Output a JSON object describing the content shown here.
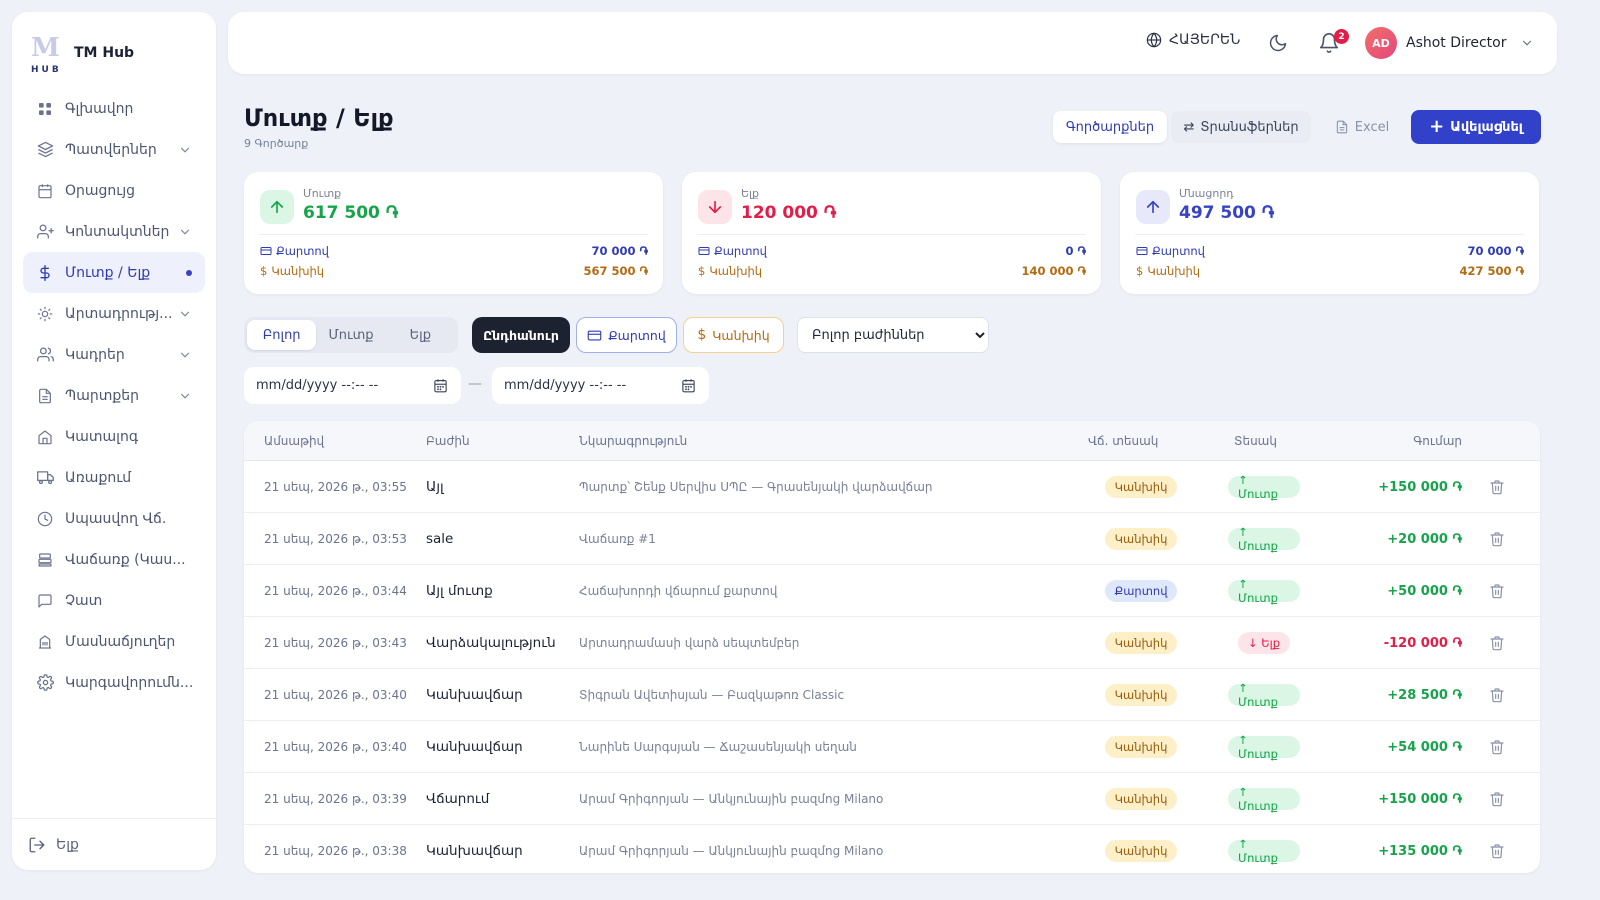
{
  "brand": {
    "name": "TM Hub",
    "logo_letters": "TM",
    "logo_sub": "HUB"
  },
  "sidebar": {
    "items": [
      {
        "label": "Գլխավոր",
        "icon": "grid-icon",
        "has_children": false,
        "active": false
      },
      {
        "label": "Պատվերներ",
        "icon": "layers-icon",
        "has_children": true,
        "active": false
      },
      {
        "label": "Օրացույց",
        "icon": "calendar-icon",
        "has_children": false,
        "active": false
      },
      {
        "label": "Կոնտակտներ",
        "icon": "user-plus-icon",
        "has_children": true,
        "active": false
      },
      {
        "label": "Մուտք / Ելք",
        "icon": "dollar-icon",
        "has_children": false,
        "active": true
      },
      {
        "label": "Արտադրությ...",
        "icon": "sun-icon",
        "has_children": true,
        "active": false
      },
      {
        "label": "Կադրեր",
        "icon": "users-icon",
        "has_children": true,
        "active": false
      },
      {
        "label": "Պարտքեր",
        "icon": "file-icon",
        "has_children": true,
        "active": false
      },
      {
        "label": "Կատալոգ",
        "icon": "home-icon",
        "has_children": false,
        "active": false
      },
      {
        "label": "Առաքում",
        "icon": "truck-icon",
        "has_children": false,
        "active": false
      },
      {
        "label": "Սպասվող Վճ.",
        "icon": "clock-icon",
        "has_children": false,
        "active": false
      },
      {
        "label": "Վաճառք (Կաս...",
        "icon": "register-icon",
        "has_children": false,
        "active": false
      },
      {
        "label": "Չատ",
        "icon": "chat-icon",
        "has_children": false,
        "active": false
      },
      {
        "label": "Մասնաճյուղեր",
        "icon": "building-icon",
        "has_children": false,
        "active": false
      },
      {
        "label": "Կարգավորումն...",
        "icon": "gear-icon",
        "has_children": false,
        "active": false
      }
    ],
    "logout_label": "Ելք"
  },
  "topbar": {
    "language": "ՀԱՅԵՐԵՆ",
    "notifications_count": "2",
    "user_initials": "AD",
    "user_name": "Ashot Director"
  },
  "page": {
    "title": "Մուտք / Ելք",
    "subtitle": "9 Գործարք",
    "operations_label": "Գործարքներ",
    "transfers_label": "Տրանսֆերներ",
    "excel_label": "Excel",
    "add_label": "Ավելացնել"
  },
  "cards": [
    {
      "label": "Մուտք",
      "value": "617 500 ֏",
      "color": "#16a34a",
      "icon_bg": "#dcf6e6",
      "icon": "arrow-up-icon",
      "card_label": "Քարտով",
      "card_value": "70 000 ֏",
      "cash_label": "Կանխիկ",
      "cash_value": "567 500 ֏"
    },
    {
      "label": "Ելք",
      "value": "120 000 ֏",
      "color": "#e11d48",
      "icon_bg": "#fde4e8",
      "icon": "arrow-down-icon",
      "card_label": "Քարտով",
      "card_value": "0 ֏",
      "cash_label": "Կանխիկ",
      "cash_value": "140 000 ֏"
    },
    {
      "label": "Մնացորդ",
      "value": "497 500 ֏",
      "color": "#3742c5",
      "icon_bg": "#e7e9fb",
      "icon": "arrow-up-icon",
      "card_label": "Քարտով",
      "card_value": "70 000 ֏",
      "cash_label": "Կանխիկ",
      "cash_value": "427 500 ֏"
    }
  ],
  "filters": {
    "tabs": [
      "Բոլոր",
      "Մուտք",
      "Ելք"
    ],
    "active_tab": 0,
    "chip_all": "Ընդհանուր",
    "chip_card": "Քարտով",
    "chip_cash": "Կանխիկ",
    "department_selected": "Բոլոր բաժիններ",
    "date_from": "mm/dd/yyyy --:-- --",
    "date_to": "mm/dd/yyyy --:-- --",
    "date_separator": "—"
  },
  "table": {
    "headers": [
      "Ամսաթիվ",
      "Բաժին",
      "Նկարագրություն",
      "Վճ. տեսակ",
      "Տեսակ",
      "Գումար"
    ],
    "rows": [
      {
        "date": "21 սեպ, 2026 թ., 03:55",
        "dept": "Այլ",
        "desc": "Պարտք՝ Շենք Սերվիս ՍՊԸ — Գրասենյակի վարձավճար",
        "pay": "Կանխիկ",
        "pay_kind": "cash",
        "type": "↑ Մուտք",
        "type_kind": "in",
        "amount": "+150 000 ֏"
      },
      {
        "date": "21 սեպ, 2026 թ., 03:53",
        "dept": "sale",
        "desc": "Վաճառք #1",
        "pay": "Կանխիկ",
        "pay_kind": "cash",
        "type": "↑ Մուտք",
        "type_kind": "in",
        "amount": "+20 000 ֏"
      },
      {
        "date": "21 սեպ, 2026 թ., 03:44",
        "dept": "Այլ մուտք",
        "desc": "Հաճախորդի վճարում քարտով",
        "pay": "Քարտով",
        "pay_kind": "card",
        "type": "↑ Մուտք",
        "type_kind": "in",
        "amount": "+50 000 ֏"
      },
      {
        "date": "21 սեպ, 2026 թ., 03:43",
        "dept": "Վարձակալություն",
        "desc": "Արտադրամասի վարձ սեպտեմբեր",
        "pay": "Կանխիկ",
        "pay_kind": "cash",
        "type": "↓ Ելք",
        "type_kind": "out",
        "amount": "-120 000 ֏"
      },
      {
        "date": "21 սեպ, 2026 թ., 03:40",
        "dept": "Կանխավճար",
        "desc": "Տիգրան Ավետիսյան — Բազկաթոռ Classic",
        "pay": "Կանխիկ",
        "pay_kind": "cash",
        "type": "↑ Մուտք",
        "type_kind": "in",
        "amount": "+28 500 ֏"
      },
      {
        "date": "21 սեպ, 2026 թ., 03:40",
        "dept": "Կանխավճար",
        "desc": "Նարինե Սարգսյան — Ճաշասենյակի սեղան",
        "pay": "Կանխիկ",
        "pay_kind": "cash",
        "type": "↑ Մուտք",
        "type_kind": "in",
        "amount": "+54 000 ֏"
      },
      {
        "date": "21 սեպ, 2026 թ., 03:39",
        "dept": "Վճարում",
        "desc": "Արամ Գրիգորյան — Անկյունային բազմոց Milano",
        "pay": "Կանխիկ",
        "pay_kind": "cash",
        "type": "↑ Մուտք",
        "type_kind": "in",
        "amount": "+150 000 ֏"
      },
      {
        "date": "21 սեպ, 2026 թ., 03:38",
        "dept": "Կանխավճար",
        "desc": "Արամ Գրիգորյան — Անկյունային բազմոց Milano",
        "pay": "Կանխիկ",
        "pay_kind": "cash",
        "type": "↑ Մուտք",
        "type_kind": "in",
        "amount": "+135 000 ֏"
      }
    ]
  }
}
